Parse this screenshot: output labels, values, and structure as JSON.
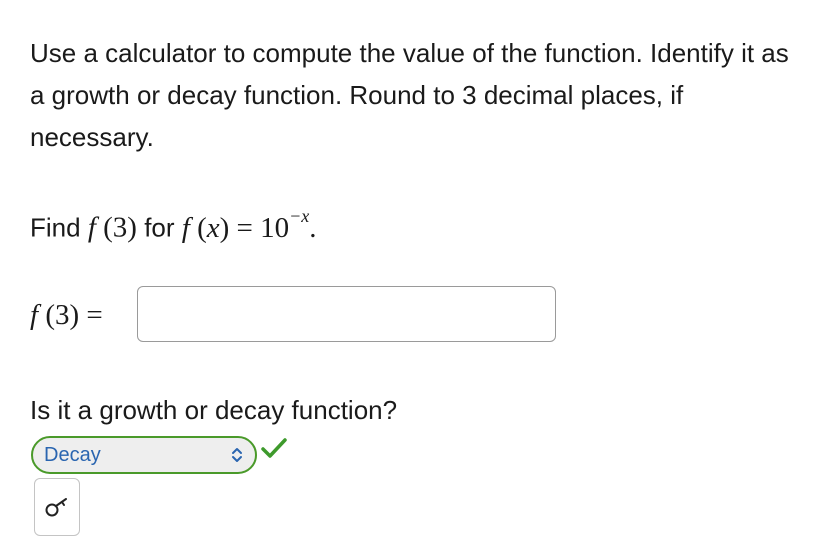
{
  "prompt": {
    "text": "Use a calculator to compute the value of the function. Identify it as a growth or decay function. Round to 3 decimal places, if necessary."
  },
  "find": {
    "lead": "Find ",
    "f1": "f",
    "arg1": " (3) ",
    "mid": " for ",
    "f2": "f",
    "arg2_open": " (",
    "var": "x",
    "arg2_close": ") = 10",
    "exponent": "−x",
    "end": "."
  },
  "answer": {
    "label_f": "f",
    "label_rest": " (3) =",
    "value": ""
  },
  "question": {
    "text": "Is it a growth or decay function?"
  },
  "select": {
    "value": "Decay",
    "status": "correct",
    "border_color": "#4a9a2a",
    "text_color": "#2a65b0"
  },
  "icons": {
    "select_arrows": "up-down-chevron-icon",
    "check": "checkmark-icon",
    "tool": "symbol-palette-icon"
  }
}
